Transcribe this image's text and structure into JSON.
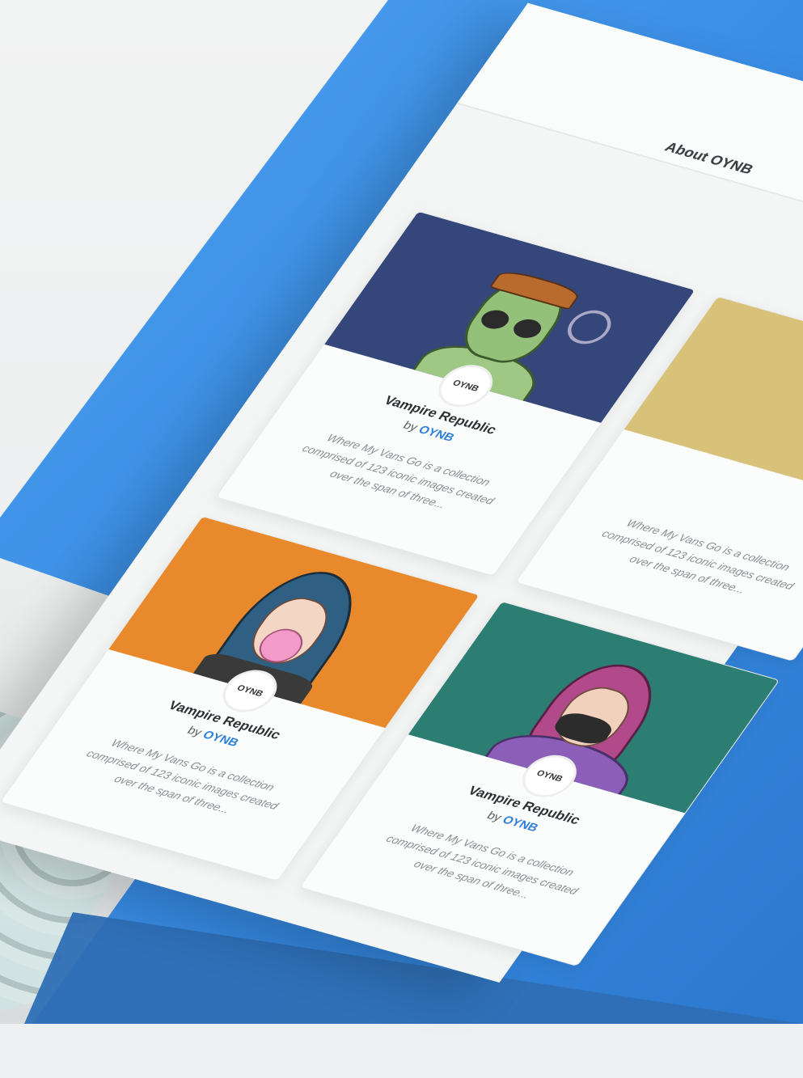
{
  "header": {
    "nav_about": "About OYNB"
  },
  "cards": [
    {
      "title": "Vampire Republic",
      "by_prefix": "by",
      "author": "OYNB",
      "badge": "OYNB",
      "description": "Where My Vans Go is a collection comprised of 123 iconic images created over the span of three...",
      "image_bg": "#34467a",
      "character": "alien-icon"
    },
    {
      "title": "Vampire Republic",
      "by_prefix": "by",
      "author": "OYNB",
      "badge": "OYNB",
      "description": "Where My Vans Go is a collection comprised of 123 iconic images created over the span of three...",
      "image_bg": "#e8892b",
      "character": "bubblegum-girl-icon"
    },
    {
      "title": "Vampire Republic",
      "by_prefix": "by",
      "author": "OYNB",
      "badge": "OYNB",
      "description": "Where My Vans Go is a collection comprised of 123 iconic images created over the span of three...",
      "image_bg": "#2c7d72",
      "character": "masked-girl-icon"
    },
    {
      "title": "",
      "by_prefix": "",
      "author": "",
      "badge": "",
      "description": "Where My Vans Go is a collection comprised of 123 iconic images created over the span of three...",
      "image_bg": "#d8c27a",
      "character": ""
    }
  ],
  "colors": {
    "brand_blue": "#3a8ee6",
    "link_blue": "#2f80d8"
  }
}
